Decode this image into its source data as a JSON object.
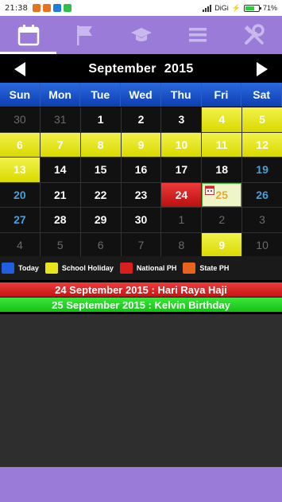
{
  "status": {
    "time": "21:38",
    "carrier": "DiGi",
    "battery": "71%",
    "battery_level": 0.71
  },
  "tabs": [
    {
      "icon": "calendar-icon",
      "active": true
    },
    {
      "icon": "flag-icon",
      "active": false
    },
    {
      "icon": "graduation-cap-icon",
      "active": false
    },
    {
      "icon": "menu-icon",
      "active": false
    },
    {
      "icon": "tools-icon",
      "active": false
    }
  ],
  "month": {
    "name": "September",
    "year": "2015"
  },
  "weekdays": [
    "Sun",
    "Mon",
    "Tue",
    "Wed",
    "Thu",
    "Fri",
    "Sat"
  ],
  "weeks": [
    [
      {
        "d": "30",
        "t": "other"
      },
      {
        "d": "31",
        "t": "other"
      },
      {
        "d": "1",
        "t": ""
      },
      {
        "d": "2",
        "t": ""
      },
      {
        "d": "3",
        "t": ""
      },
      {
        "d": "4",
        "t": "holiday"
      },
      {
        "d": "5",
        "t": "holiday"
      }
    ],
    [
      {
        "d": "6",
        "t": "holiday"
      },
      {
        "d": "7",
        "t": "holiday"
      },
      {
        "d": "8",
        "t": "holiday"
      },
      {
        "d": "9",
        "t": "holiday"
      },
      {
        "d": "10",
        "t": "holiday"
      },
      {
        "d": "11",
        "t": "holiday"
      },
      {
        "d": "12",
        "t": "holiday"
      }
    ],
    [
      {
        "d": "13",
        "t": "holiday"
      },
      {
        "d": "14",
        "t": ""
      },
      {
        "d": "15",
        "t": ""
      },
      {
        "d": "16",
        "t": ""
      },
      {
        "d": "17",
        "t": ""
      },
      {
        "d": "18",
        "t": ""
      },
      {
        "d": "19",
        "t": "sun"
      }
    ],
    [
      {
        "d": "20",
        "t": "sun"
      },
      {
        "d": "21",
        "t": ""
      },
      {
        "d": "22",
        "t": ""
      },
      {
        "d": "23",
        "t": ""
      },
      {
        "d": "24",
        "t": "national"
      },
      {
        "d": "25",
        "t": "today",
        "event": true
      },
      {
        "d": "26",
        "t": "sun"
      }
    ],
    [
      {
        "d": "27",
        "t": "sun"
      },
      {
        "d": "28",
        "t": ""
      },
      {
        "d": "29",
        "t": ""
      },
      {
        "d": "30",
        "t": ""
      },
      {
        "d": "1",
        "t": "other"
      },
      {
        "d": "2",
        "t": "other"
      },
      {
        "d": "3",
        "t": "other"
      }
    ],
    [
      {
        "d": "4",
        "t": "other"
      },
      {
        "d": "5",
        "t": "other"
      },
      {
        "d": "6",
        "t": "other"
      },
      {
        "d": "7",
        "t": "other"
      },
      {
        "d": "8",
        "t": "other"
      },
      {
        "d": "9",
        "t": "holiday other"
      },
      {
        "d": "10",
        "t": "other"
      }
    ]
  ],
  "legend": [
    {
      "label": "Today",
      "color": "#1f5fe0"
    },
    {
      "label": "School Holiday",
      "color": "#e6e61a"
    },
    {
      "label": "National PH",
      "color": "#d81e1e"
    },
    {
      "label": "State PH",
      "color": "#e8641e"
    }
  ],
  "events": [
    {
      "text": "24 September 2015 : Hari Raya Haji",
      "style": "red"
    },
    {
      "text": "25 September 2015 : Kelvin Birthday",
      "style": "green"
    }
  ]
}
